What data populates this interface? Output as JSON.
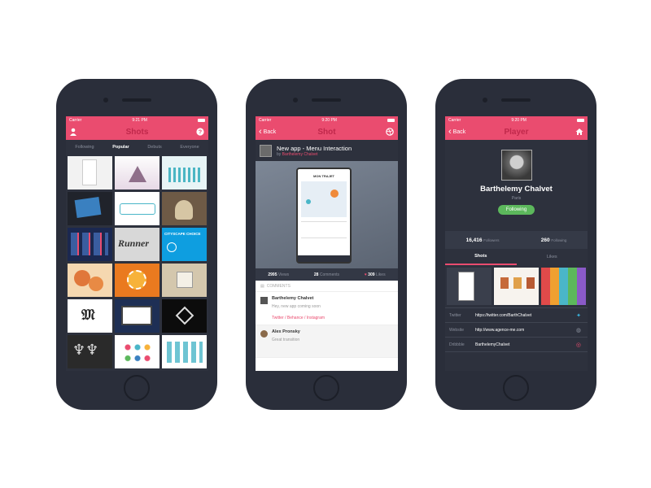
{
  "colors": {
    "accent": "#ea4c6f",
    "dark": "#2d313d",
    "follow": "#5cb85c",
    "twitter": "#39b8e3"
  },
  "screen1": {
    "status": {
      "carrier": "Carrier",
      "time": "9:21 PM"
    },
    "title": "Shots",
    "tabs": [
      "Following",
      "Popular",
      "Debuts",
      "Everyone"
    ],
    "active_tab": "Popular",
    "icons": {
      "left": "user-icon",
      "right": "help-icon"
    },
    "thumbs": [
      {
        "text": ""
      },
      {
        "text": ""
      },
      {
        "text": ""
      },
      {
        "text": ""
      },
      {
        "text": ""
      },
      {
        "text": ""
      },
      {
        "text": ""
      },
      {
        "text": "Runner"
      },
      {
        "text": "CITYSCAPE CHOICE"
      },
      {
        "text": ""
      },
      {
        "text": ""
      },
      {
        "text": ""
      },
      {
        "text": ""
      },
      {
        "text": ""
      },
      {
        "text": ""
      },
      {
        "text": ""
      },
      {
        "text": ""
      },
      {
        "text": ""
      }
    ]
  },
  "screen2": {
    "status": {
      "carrier": "Carrier",
      "time": "9:20 PM"
    },
    "back": "Back",
    "title": "Shot",
    "shot_title": "New app - Menu Interaction",
    "by": "by",
    "author": "Barthelemy Chalvet",
    "device_title": "MON TRAJET",
    "stats": [
      {
        "value": "2995",
        "label": "Views"
      },
      {
        "value": "28",
        "label": "Comments"
      },
      {
        "value": "309",
        "label": "Likes"
      }
    ],
    "comments_header": "COMMENTS",
    "comments": [
      {
        "name": "Barthelemy Chalvet",
        "text": "Hey, new app coming soon",
        "link": "Twitter / Behance / Instagram"
      },
      {
        "name": "Alex Pronsky",
        "text": "Great transition"
      }
    ]
  },
  "screen3": {
    "status": {
      "carrier": "Carrier",
      "time": "9:20 PM"
    },
    "back": "Back",
    "title": "Player",
    "name": "Barthelemy Chalvet",
    "location": "Paris",
    "follow_label": "Following",
    "followers": {
      "value": "16,416",
      "label": "Followers"
    },
    "following": {
      "value": "260",
      "label": "Following"
    },
    "tabs": [
      "Shots",
      "Likes"
    ],
    "active_tab": "Shots",
    "links": [
      {
        "key": "Twitter",
        "value": "https://twitter.com/BarthChalvet",
        "icon": "twitter-icon"
      },
      {
        "key": "Website",
        "value": "http://www.agence-me.com",
        "icon": "globe-icon"
      },
      {
        "key": "Dribbble",
        "value": "BarthelemyChalvet",
        "icon": "dribbble-icon"
      }
    ]
  }
}
